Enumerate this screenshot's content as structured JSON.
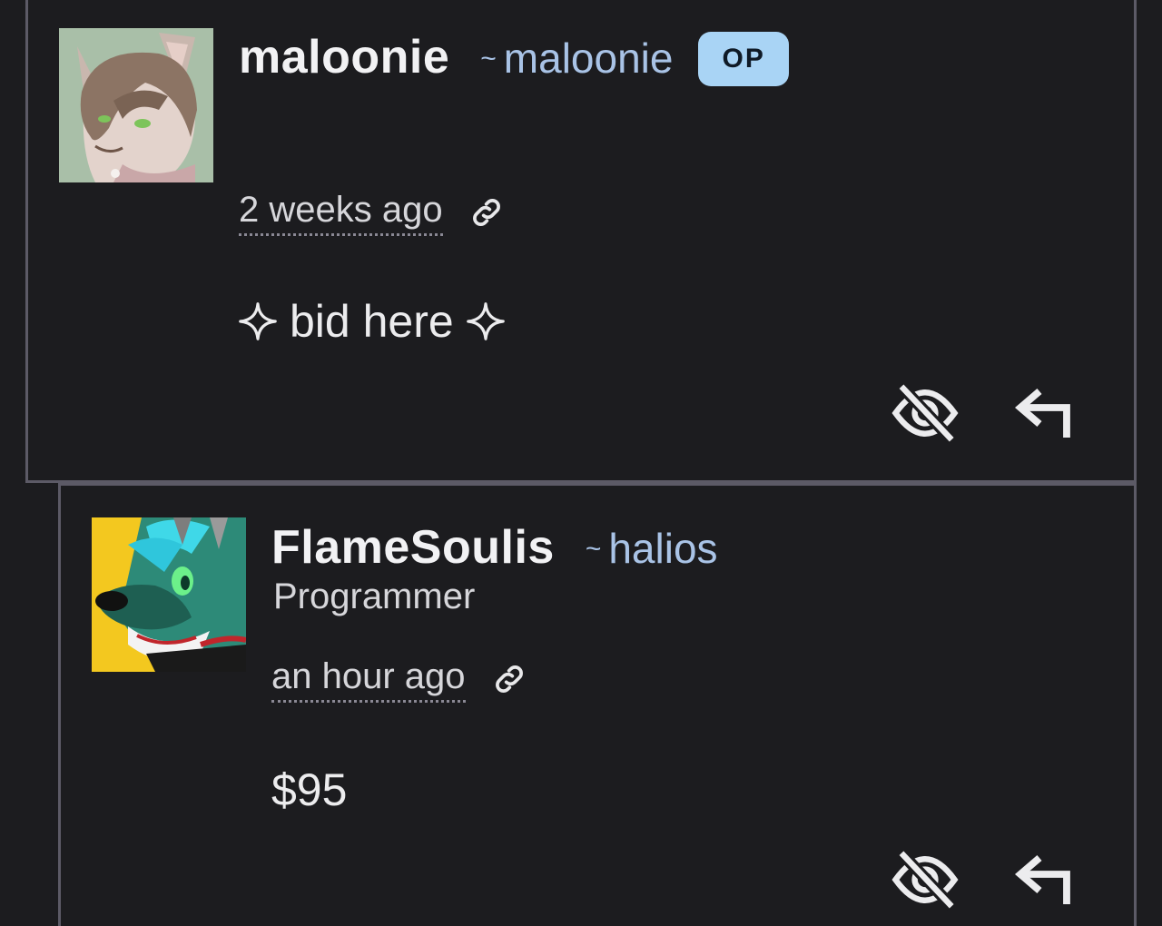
{
  "comments": [
    {
      "display_name": "maloonie",
      "handle_tilde": "~",
      "handle": "maloonie",
      "badge": "OP",
      "timestamp": "2 weeks ago",
      "body": "bid here",
      "avatar_icon": "cat-character-avatar",
      "actions": [
        "hide-icon",
        "reply-icon"
      ]
    },
    {
      "display_name": "FlameSoulis",
      "handle_tilde": "~",
      "handle": "halios",
      "user_title": "Programmer",
      "timestamp": "an hour ago",
      "body": "$95",
      "avatar_icon": "wolf-character-avatar",
      "actions": [
        "hide-icon",
        "reply-icon"
      ]
    }
  ],
  "colors": {
    "background": "#1c1c1f",
    "border": "#5c5a66",
    "handle": "#a9c3e6",
    "badge_bg": "#a9d4f5"
  }
}
